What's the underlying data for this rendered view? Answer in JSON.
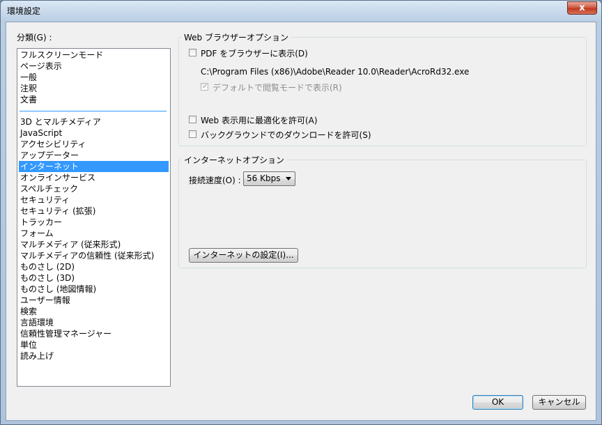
{
  "window": {
    "title": "環境設定",
    "close_label": "x"
  },
  "categories": {
    "label": "分類(G) :",
    "items_top": [
      "フルスクリーンモード",
      "ページ表示",
      "一般",
      "注釈",
      "文書"
    ],
    "items_bottom": [
      "3D とマルチメディア",
      "JavaScript",
      "アクセシビリティ",
      "アップデーター",
      "インターネット",
      "オンラインサービス",
      "スペルチェック",
      "セキュリティ",
      "セキュリティ (拡張)",
      "トラッカー",
      "フォーム",
      "マルチメディア (従来形式)",
      "マルチメディアの信頼性 (従来形式)",
      "ものさし (2D)",
      "ものさし (3D)",
      "ものさし (地図情報)",
      "ユーザー情報",
      "検索",
      "言語環境",
      "信頼性管理マネージャー",
      "単位",
      "読み上げ"
    ],
    "selected": "インターネット"
  },
  "web_options": {
    "title": "Web ブラウザーオプション",
    "show_in_browser": "PDF をブラウザーに表示(D)",
    "reader_path": "C:\\Program Files (x86)\\Adobe\\Reader 10.0\\Reader\\AcroRd32.exe",
    "default_read_mode": "デフォルトで閲覧モードで表示(R)",
    "fast_web_view": "Web 表示用に最適化を許可(A)",
    "background_download": "バックグラウンドでのダウンロードを許可(S)"
  },
  "internet_options": {
    "title": "インターネットオプション",
    "speed_label": "接続速度(O) :",
    "speed_value": "56 Kbps",
    "settings_button": "インターネットの設定(I)..."
  },
  "footer": {
    "ok": "OK",
    "cancel": "キャンセル"
  }
}
